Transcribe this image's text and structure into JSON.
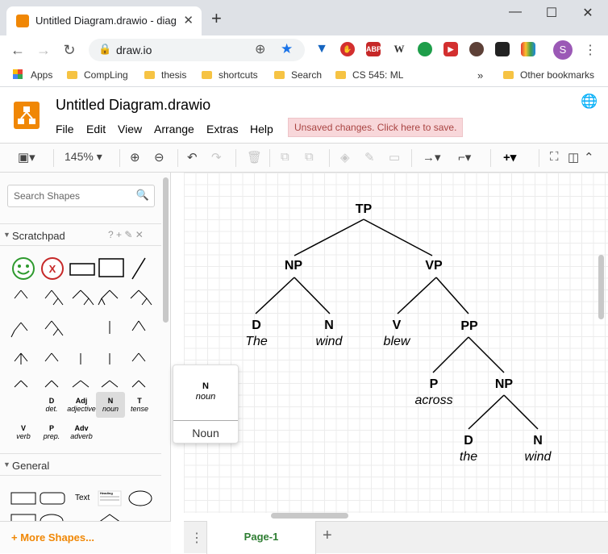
{
  "browser": {
    "tab_title": "Untitled Diagram.drawio - diagra",
    "tab_close": "✕",
    "new_tab": "+",
    "url": "draw.io",
    "profile_initial": "S",
    "window_buttons": [
      "—",
      "☐",
      "✕"
    ]
  },
  "bookmarks": {
    "items": [
      "Apps",
      "CompLing",
      "thesis",
      "shortcuts",
      "Search",
      "CS 545: ML"
    ],
    "overflow": "»",
    "other": "Other bookmarks"
  },
  "app": {
    "title": "Untitled Diagram.drawio",
    "menus": [
      "File",
      "Edit",
      "View",
      "Arrange",
      "Extras",
      "Help"
    ],
    "unsaved_notice": "Unsaved changes. Click here to save.",
    "zoom": "145%",
    "accent_color": "#f08705"
  },
  "sidebar": {
    "search_placeholder": "Search Shapes",
    "scratchpad_label": "Scratchpad",
    "scratchpad_tools": "? + ✎ ✕",
    "general_label": "General",
    "more_shapes": "+ More Shapes...",
    "shapes": [
      {
        "cat": "D",
        "word": "det."
      },
      {
        "cat": "Adj",
        "word": "adjective"
      },
      {
        "cat": "N",
        "word": "noun"
      },
      {
        "cat": "T",
        "word": "tense"
      },
      {
        "cat": "V",
        "word": "verb"
      },
      {
        "cat": "P",
        "word": "prep."
      },
      {
        "cat": "Adv",
        "word": "adverb"
      }
    ],
    "general_text": "Text",
    "general_heading": "Heading"
  },
  "popup": {
    "cat": "N",
    "word": "noun",
    "label": "Noun"
  },
  "tree": {
    "tp": "TP",
    "np1": "NP",
    "vp": "VP",
    "d1": {
      "cat": "D",
      "word": "The"
    },
    "n1": {
      "cat": "N",
      "word": "wind"
    },
    "v": {
      "cat": "V",
      "word": "blew"
    },
    "pp": "PP",
    "p": {
      "cat": "P",
      "word": "across"
    },
    "np2": "NP",
    "d2": {
      "cat": "D",
      "word": "the"
    },
    "n2": {
      "cat": "N",
      "word": "wind"
    }
  },
  "pages": {
    "current": "Page-1",
    "add": "+"
  }
}
